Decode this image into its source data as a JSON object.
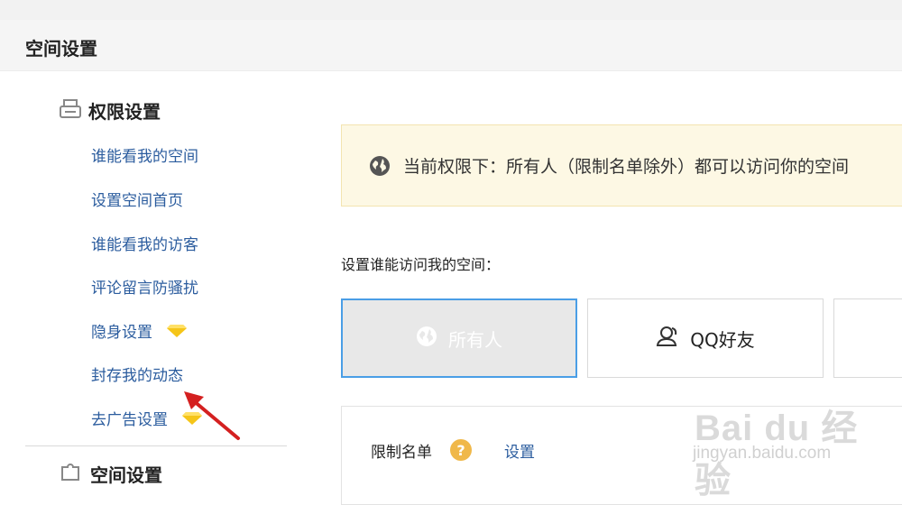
{
  "header": {
    "title": "空间设置"
  },
  "sidebar": {
    "section_permissions": {
      "label": "权限设置",
      "icon": "printer-icon"
    },
    "items": [
      {
        "label": "谁能看我的空间"
      },
      {
        "label": "设置空间首页"
      },
      {
        "label": "谁能看我的访客"
      },
      {
        "label": "评论留言防骚扰"
      },
      {
        "label": "隐身设置",
        "badge_icon": "diamond-icon"
      },
      {
        "label": "封存我的动态"
      },
      {
        "label": "去广告设置",
        "badge_icon": "diamond-icon"
      }
    ],
    "section_space": {
      "label": "空间设置",
      "icon": "puzzle-icon"
    }
  },
  "notice": {
    "icon": "globe-icon",
    "text": "当前权限下：所有人（限制名单除外）都可以访问你的空间"
  },
  "access": {
    "prompt": "设置谁能访问我的空间：",
    "options": [
      {
        "label": "所有人",
        "icon": "globe-icon",
        "selected": true
      },
      {
        "label": "QQ好友",
        "icon": "friends-icon",
        "selected": false
      }
    ]
  },
  "restriction": {
    "label": "限制名单",
    "help_icon": "question-icon",
    "help_text": "?",
    "link": "设置"
  },
  "watermark": {
    "brand": "Bai du 经验",
    "url": "jingyan.baidu.com"
  },
  "colors": {
    "link": "#2b5c9e",
    "selected_border": "#4a9ee6",
    "notice_bg": "#fdf8e4",
    "diamond": "#f5c518",
    "arrow": "#d42020"
  }
}
